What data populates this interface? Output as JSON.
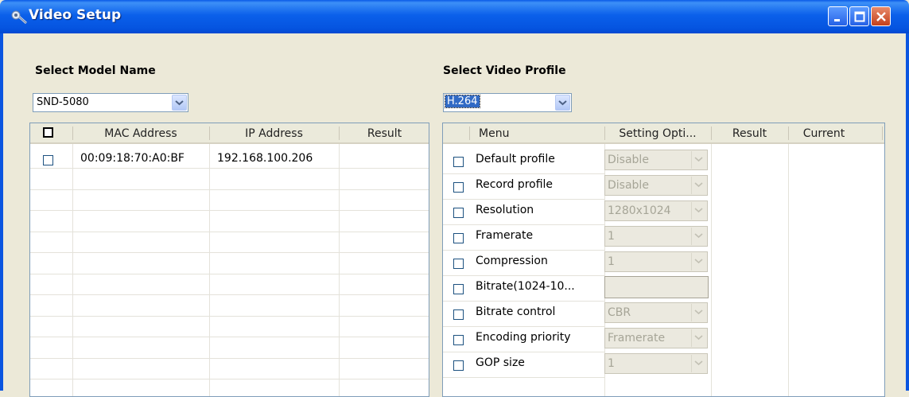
{
  "window": {
    "title": "Video Setup"
  },
  "model": {
    "label": "Select Model Name",
    "selected": "SND-5080"
  },
  "profile": {
    "label": "Select Video Profile",
    "selected": "H.264"
  },
  "left_table": {
    "headers": [
      "MAC Address",
      "IP Address",
      "Result"
    ],
    "rows": [
      {
        "mac": "00:09:18:70:A0:BF",
        "ip": "192.168.100.206",
        "result": ""
      }
    ]
  },
  "right_table": {
    "headers": [
      "Menu",
      "Setting Opti...",
      "Result",
      "Current"
    ],
    "rows": [
      {
        "menu": "Default profile",
        "value": "Disable",
        "kind": "dropdown"
      },
      {
        "menu": "Record profile",
        "value": "Disable",
        "kind": "dropdown"
      },
      {
        "menu": "Resolution",
        "value": "1280x1024",
        "kind": "dropdown"
      },
      {
        "menu": "Framerate",
        "value": "1",
        "kind": "dropdown"
      },
      {
        "menu": "Compression",
        "value": "1",
        "kind": "dropdown"
      },
      {
        "menu": "Bitrate(1024-10...",
        "value": "",
        "kind": "text"
      },
      {
        "menu": "Bitrate control",
        "value": "CBR",
        "kind": "dropdown"
      },
      {
        "menu": "Encoding priority",
        "value": "Framerate",
        "kind": "dropdown"
      },
      {
        "menu": "GOP size",
        "value": "1",
        "kind": "dropdown"
      }
    ]
  },
  "icons": {
    "app": "camera-setup-icon",
    "minimize": "minimize-icon",
    "maximize": "maximize-icon",
    "close": "close-icon"
  }
}
